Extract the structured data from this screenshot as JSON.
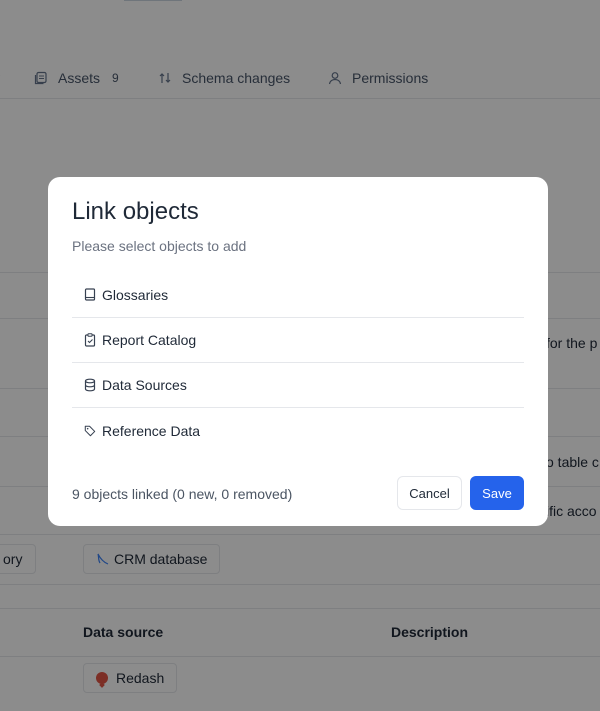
{
  "tabs": [
    {
      "label": "Assets",
      "count": "9",
      "icon": "assets-icon"
    },
    {
      "label": "Schema changes",
      "icon": "schema-changes-icon"
    },
    {
      "label": "Permissions",
      "icon": "user-icon"
    }
  ],
  "background": {
    "row_texts": {
      "r1": "for the p",
      "r2": "o table c",
      "r3": "ific acco"
    },
    "chip_left": "ory",
    "chip_crm": "CRM database",
    "table_headers": {
      "data_source": "Data source",
      "description": "Description"
    },
    "redash_chip": "Redash"
  },
  "modal": {
    "title": "Link objects",
    "subtitle": "Please select objects to add",
    "items": [
      {
        "label": "Glossaries",
        "icon": "book-icon"
      },
      {
        "label": "Report Catalog",
        "icon": "clipboard-icon"
      },
      {
        "label": "Data Sources",
        "icon": "database-icon"
      },
      {
        "label": "Reference Data",
        "icon": "tag-icon"
      }
    ],
    "footer_note": "9 objects linked (0 new, 0 removed)",
    "cancel_label": "Cancel",
    "save_label": "Save"
  },
  "colors": {
    "primary": "#2563eb",
    "overlay": "rgba(0,0,0,0.45)"
  }
}
